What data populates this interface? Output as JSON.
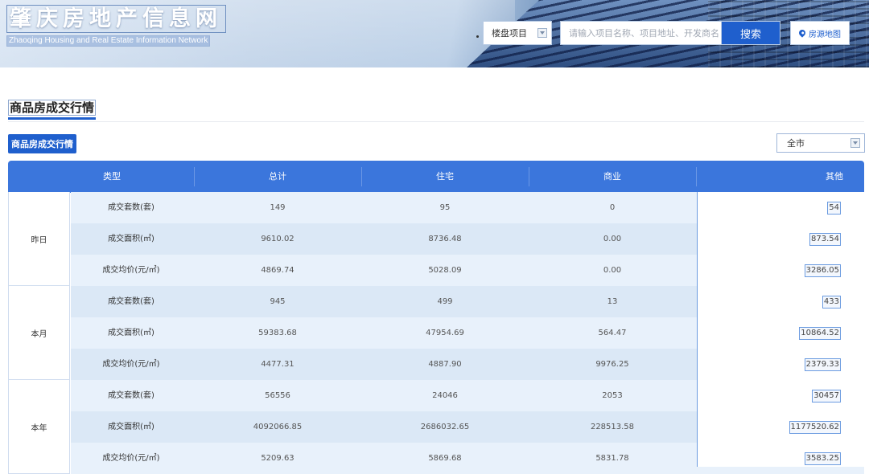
{
  "header": {
    "site_name_cn": "肇庆房地产信息网",
    "site_name_en": "Zhaoqing Housing and Real Estate Information Network",
    "select_label": "楼盘项目",
    "search_placeholder": "请输入项目名称、项目地址、开发商名称",
    "search_button": "搜索",
    "map_button": "房源地图"
  },
  "section": {
    "title": "商品房成交行情",
    "tab_label": "商品房成交行情",
    "city_filter": "全市"
  },
  "table": {
    "headers": [
      "类型",
      "总计",
      "住宅",
      "商业",
      "其他"
    ],
    "groups": [
      {
        "label": "昨日",
        "rows": [
          {
            "type": "成交套数(套)",
            "total": "149",
            "residential": "95",
            "commercial": "0",
            "other": "54"
          },
          {
            "type": "成交面积(㎡)",
            "total": "9610.02",
            "residential": "8736.48",
            "commercial": "0.00",
            "other": "873.54"
          },
          {
            "type": "成交均价(元/㎡)",
            "total": "4869.74",
            "residential": "5028.09",
            "commercial": "0.00",
            "other": "3286.05"
          }
        ]
      },
      {
        "label": "本月",
        "rows": [
          {
            "type": "成交套数(套)",
            "total": "945",
            "residential": "499",
            "commercial": "13",
            "other": "433"
          },
          {
            "type": "成交面积(㎡)",
            "total": "59383.68",
            "residential": "47954.69",
            "commercial": "564.47",
            "other": "10864.52"
          },
          {
            "type": "成交均价(元/㎡)",
            "total": "4477.31",
            "residential": "4887.90",
            "commercial": "9976.25",
            "other": "2379.33"
          }
        ]
      },
      {
        "label": "本年",
        "rows": [
          {
            "type": "成交套数(套)",
            "total": "56556",
            "residential": "24046",
            "commercial": "2053",
            "other": "30457"
          },
          {
            "type": "成交面积(㎡)",
            "total": "4092066.85",
            "residential": "2686032.65",
            "commercial": "228513.58",
            "other": "1177520.62"
          },
          {
            "type": "成交均价(元/㎡)",
            "total": "5209.63",
            "residential": "5869.68",
            "commercial": "5831.78",
            "other": "3583.25"
          }
        ]
      }
    ]
  },
  "colors": {
    "accent": "#1f5fcd",
    "table_header": "#3b76dc",
    "row_light": "#e8f1fb",
    "row_dark": "#dbe8f6"
  }
}
